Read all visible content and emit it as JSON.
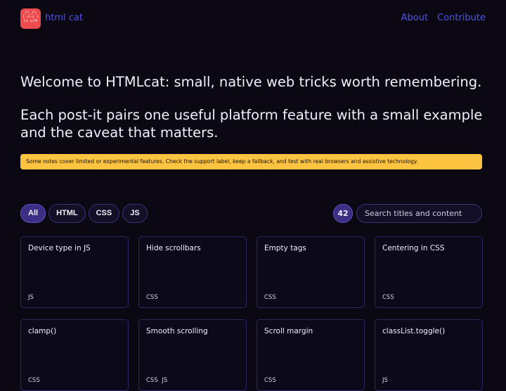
{
  "header": {
    "logo_text": "/\\_/\\\n( o.o )\n(u u)ᕗ",
    "brand": "html cat",
    "nav": [
      "About",
      "Contribute"
    ]
  },
  "intro": {
    "line1": "Welcome to HTMLcat: small, native web tricks worth remembering.",
    "line2": "Each post-it pairs one useful platform feature with a small example and the caveat that matters."
  },
  "notice": "Some notes cover limited or experimental features. Check the support label, keep a fallback, and test with real browsers and assistive technology.",
  "filters": [
    "All",
    "HTML",
    "CSS",
    "JS"
  ],
  "active_filter": "All",
  "count": "42",
  "search": {
    "placeholder": "Search titles and content",
    "value": ""
  },
  "cards": [
    {
      "title": "Device type in JS",
      "tags": "JS"
    },
    {
      "title": "Hide scrollbars",
      "tags": "CSS"
    },
    {
      "title": "Empty tags",
      "tags": "CSS"
    },
    {
      "title": "Centering in CSS",
      "tags": "CSS"
    },
    {
      "title": "clamp()",
      "tags": "CSS"
    },
    {
      "title": "Smooth scrolling",
      "tags": "CSS JS"
    },
    {
      "title": "Scroll margin",
      "tags": "CSS"
    },
    {
      "title": "classList.toggle()",
      "tags": "JS"
    }
  ],
  "colors": {
    "background": "#0b0814",
    "accent": "#4c54e8",
    "logo": "#ee4b4f",
    "notice": "#fcc440",
    "active_chip": "#3a2f84"
  }
}
